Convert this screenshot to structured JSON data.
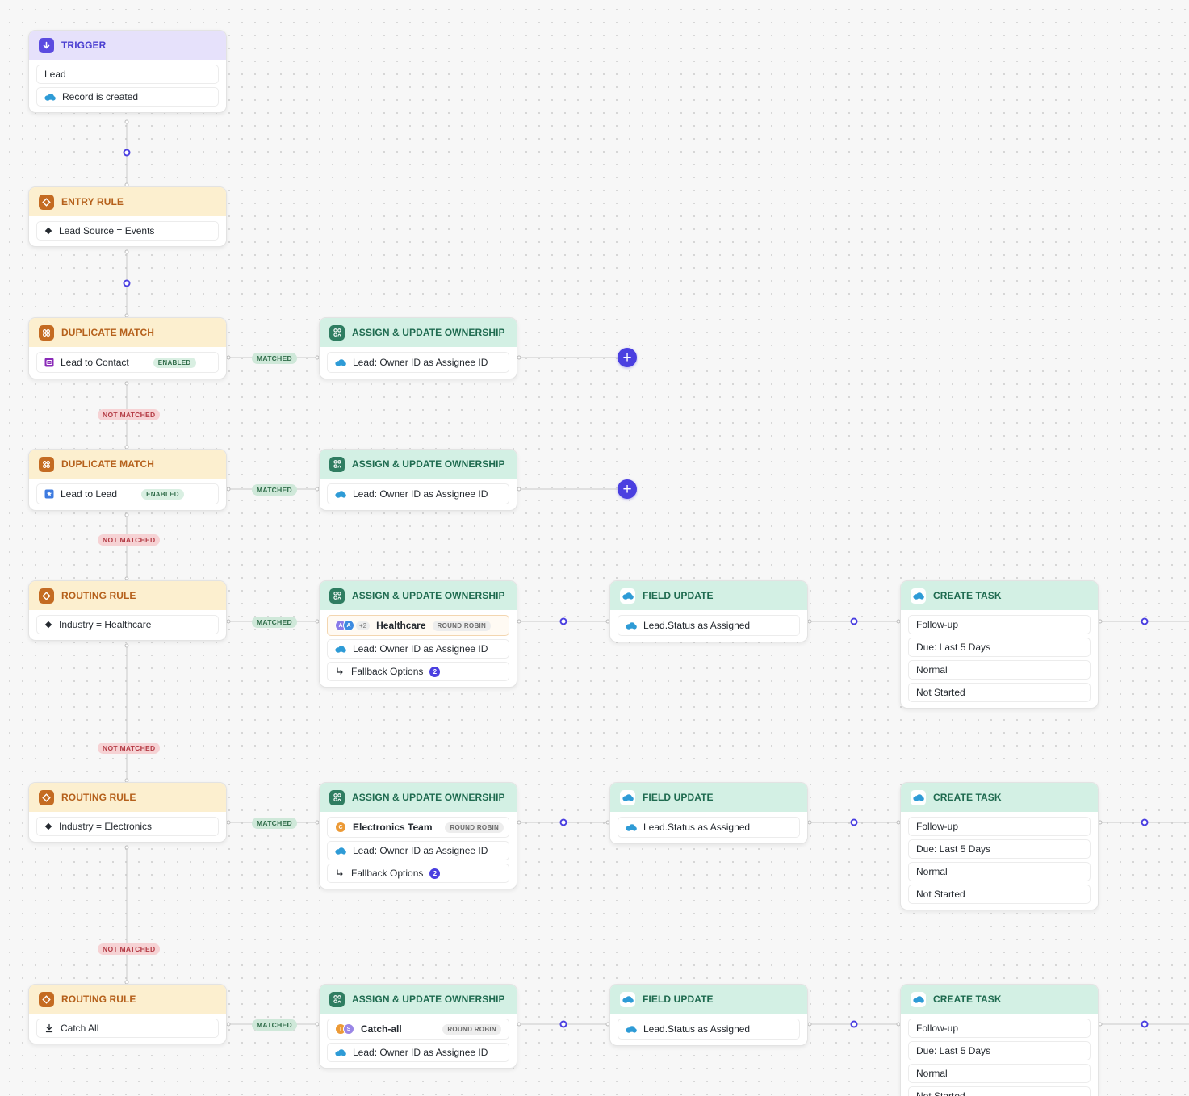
{
  "trigger": {
    "title": "TRIGGER",
    "object": "Lead",
    "event": "Record is created"
  },
  "entry_rule": {
    "title": "ENTRY RULE",
    "condition": "Lead Source = Events"
  },
  "duplicate_match_1": {
    "title": "DUPLICATE MATCH",
    "label": "Lead to Contact",
    "status": "ENABLED"
  },
  "duplicate_match_2": {
    "title": "DUPLICATE MATCH",
    "label": "Lead to Lead",
    "status": "ENABLED"
  },
  "routing_rule_1": {
    "title": "ROUTING RULE",
    "condition": "Industry = Healthcare"
  },
  "routing_rule_2": {
    "title": "ROUTING RULE",
    "condition": "Industry = Electronics"
  },
  "routing_rule_3": {
    "title": "ROUTING RULE",
    "condition": "Catch All"
  },
  "labels": {
    "matched": "MATCHED",
    "not_matched": "NOT MATCHED",
    "round_robin": "ROUND ROBIN"
  },
  "assign_1": {
    "title": "ASSIGN & UPDATE OWNERSHIP",
    "mapping": "Lead: Owner ID as Assignee ID"
  },
  "assign_2": {
    "title": "ASSIGN & UPDATE OWNERSHIP",
    "mapping": "Lead: Owner ID as Assignee ID"
  },
  "assign_3": {
    "title": "ASSIGN & UPDATE OWNERSHIP",
    "team": "Healthcare",
    "avatars": [
      "A",
      "A"
    ],
    "more": "+2",
    "mapping": "Lead: Owner ID as Assignee ID",
    "fallback": "Fallback Options",
    "fallback_count": "2"
  },
  "assign_4": {
    "title": "ASSIGN & UPDATE OWNERSHIP",
    "team": "Electronics Team",
    "avatars": [
      "C"
    ],
    "mapping": "Lead: Owner ID as Assignee ID",
    "fallback": "Fallback Options",
    "fallback_count": "2"
  },
  "assign_5": {
    "title": "ASSIGN & UPDATE OWNERSHIP",
    "team": "Catch-all",
    "avatars": [
      "T",
      "S"
    ],
    "mapping": "Lead: Owner ID as Assignee ID"
  },
  "field_update": {
    "title": "FIELD UPDATE",
    "value": "Lead.Status as Assigned"
  },
  "create_task": {
    "title": "CREATE TASK",
    "subject": "Follow-up",
    "due": "Due: Last 5 Days",
    "priority": "Normal",
    "status": "Not Started"
  },
  "colors": {
    "accent": "#4a3fe0",
    "trigger": "#5b4be0",
    "rule": "#c46b22",
    "action": "#2f7d61",
    "salesforce": "#2e9bd6"
  }
}
